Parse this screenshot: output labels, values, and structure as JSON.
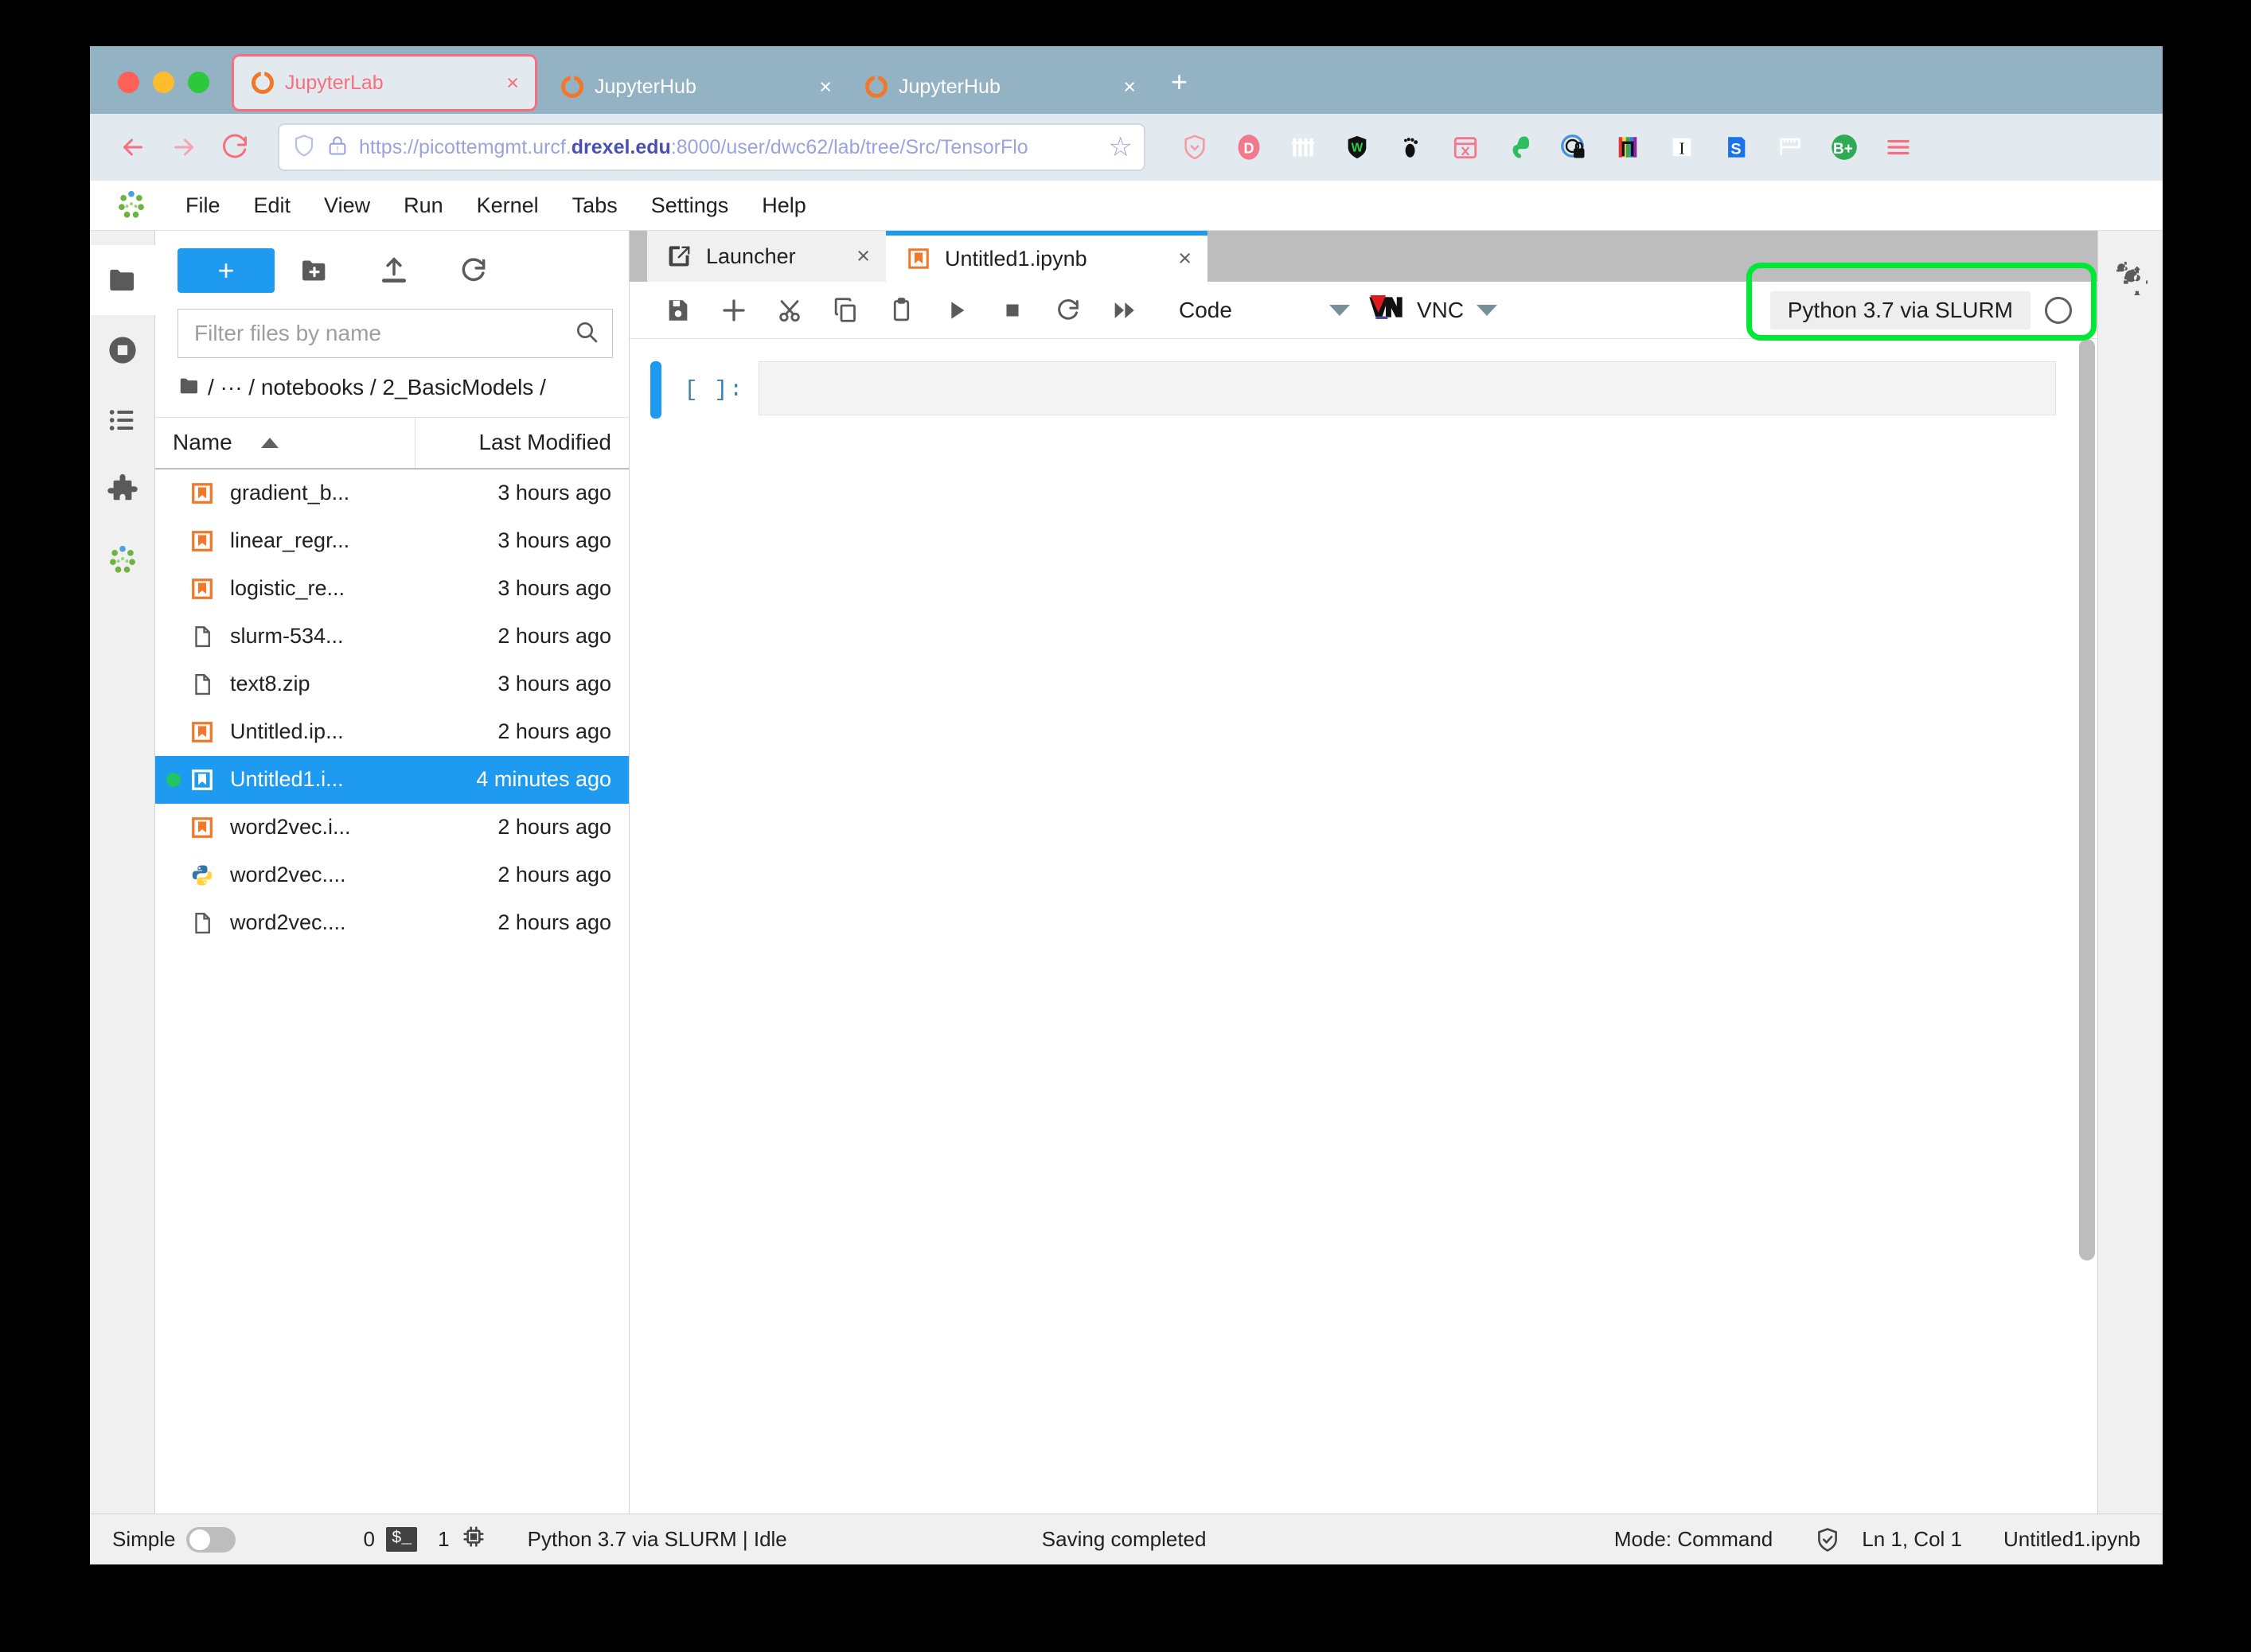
{
  "browser": {
    "window_controls": [
      "close",
      "minimize",
      "maximize"
    ],
    "tabs": [
      {
        "title": "JupyterLab",
        "active": true,
        "close_label": "×"
      },
      {
        "title": "JupyterHub",
        "active": false,
        "close_label": "×"
      },
      {
        "title": "JupyterHub",
        "active": false,
        "close_label": "×"
      }
    ],
    "new_tab_label": "+",
    "nav": {
      "back_label": "←",
      "forward_label": "→",
      "reload_label": "↻"
    },
    "url": {
      "prefix": "https://picottemgmt.urcf.",
      "domain": "drexel.edu",
      "suffix": ":8000/user/dwc62/lab/tree/Src/TensorFlo",
      "bookmark_label": "☆"
    },
    "extensions": [
      "shield-icon",
      "d-badge-icon",
      "columns-icon",
      "w-shield-icon",
      "footprint-icon",
      "pocket-icon",
      "evernote-icon",
      "lastpass-icon",
      "rainbow-icon",
      "italic-icon",
      "s-badge-icon",
      "ruler-icon",
      "bplus-icon",
      "hamburger-menu-icon"
    ],
    "accent_color": "#f76e7e",
    "tabbar_color": "#93b2c4"
  },
  "jupyterlab": {
    "menu": [
      "File",
      "Edit",
      "View",
      "Run",
      "Kernel",
      "Tabs",
      "Settings",
      "Help"
    ],
    "activity_bar": [
      {
        "name": "file-browser",
        "active": true
      },
      {
        "name": "running-sessions",
        "active": false
      },
      {
        "name": "commands",
        "active": false
      },
      {
        "name": "extension-manager",
        "active": false
      },
      {
        "name": "jupyter-logo",
        "active": false
      }
    ],
    "right_bar": [
      {
        "name": "property-inspector",
        "active": false
      }
    ],
    "file_browser": {
      "new_launcher_label": "+",
      "tools": [
        "new-folder",
        "upload",
        "refresh"
      ],
      "filter_placeholder": "Filter files by name",
      "filter_value": "",
      "breadcrumb": "/ ··· / notebooks / 2_BasicModels /",
      "columns": {
        "name": "Name",
        "last_modified": "Last Modified"
      },
      "sort": "ascending",
      "files": [
        {
          "name": "gradient_b...",
          "modified": "3 hours ago",
          "icon": "notebook-icon",
          "selected": false,
          "running": false
        },
        {
          "name": "linear_regr...",
          "modified": "3 hours ago",
          "icon": "notebook-icon",
          "selected": false,
          "running": false
        },
        {
          "name": "logistic_re...",
          "modified": "3 hours ago",
          "icon": "notebook-icon",
          "selected": false,
          "running": false
        },
        {
          "name": "slurm-534...",
          "modified": "2 hours ago",
          "icon": "file-icon",
          "selected": false,
          "running": false
        },
        {
          "name": "text8.zip",
          "modified": "3 hours ago",
          "icon": "file-icon",
          "selected": false,
          "running": false
        },
        {
          "name": "Untitled.ip...",
          "modified": "2 hours ago",
          "icon": "notebook-icon",
          "selected": false,
          "running": false
        },
        {
          "name": "Untitled1.i...",
          "modified": "4 minutes ago",
          "icon": "notebook-icon",
          "selected": true,
          "running": true
        },
        {
          "name": "word2vec.i...",
          "modified": "2 hours ago",
          "icon": "notebook-icon",
          "selected": false,
          "running": false
        },
        {
          "name": "word2vec....",
          "modified": "2 hours ago",
          "icon": "python-icon",
          "selected": false,
          "running": false
        },
        {
          "name": "word2vec....",
          "modified": "2 hours ago",
          "icon": "file-icon",
          "selected": false,
          "running": false
        }
      ]
    },
    "dock_tabs": [
      {
        "label": "Launcher",
        "icon": "launcher-icon",
        "current": false,
        "close_label": "×"
      },
      {
        "label": "Untitled1.ipynb",
        "icon": "notebook-icon",
        "current": true,
        "close_label": "×"
      }
    ],
    "notebook_toolbar": {
      "buttons": [
        "save-icon",
        "insert-cell-icon",
        "cut-icon",
        "copy-icon",
        "paste-icon",
        "run-icon",
        "stop-icon",
        "restart-icon",
        "restart-run-all-icon"
      ],
      "cell_type": "Code",
      "vnc_label": "VNC",
      "kernel_name": "Python 3.7 via SLURM",
      "kernel_busy": false
    },
    "notebook": {
      "cells": [
        {
          "prompt": "[ ]:",
          "source": "",
          "selected": true
        }
      ]
    },
    "status_bar": {
      "simple_label": "Simple",
      "simple_on": false,
      "terminals_count": "0",
      "terminal_badge": "$_",
      "kernels_count": "1",
      "kernel_status": "Python 3.7 via SLURM | Idle",
      "save_status": "Saving completed",
      "mode": "Mode: Command",
      "cursor": "Ln 1, Col 1",
      "filename": "Untitled1.ipynb"
    },
    "annotation": {
      "highlight_color": "#00e834",
      "highlight_target": "kernel-name-chip"
    }
  }
}
